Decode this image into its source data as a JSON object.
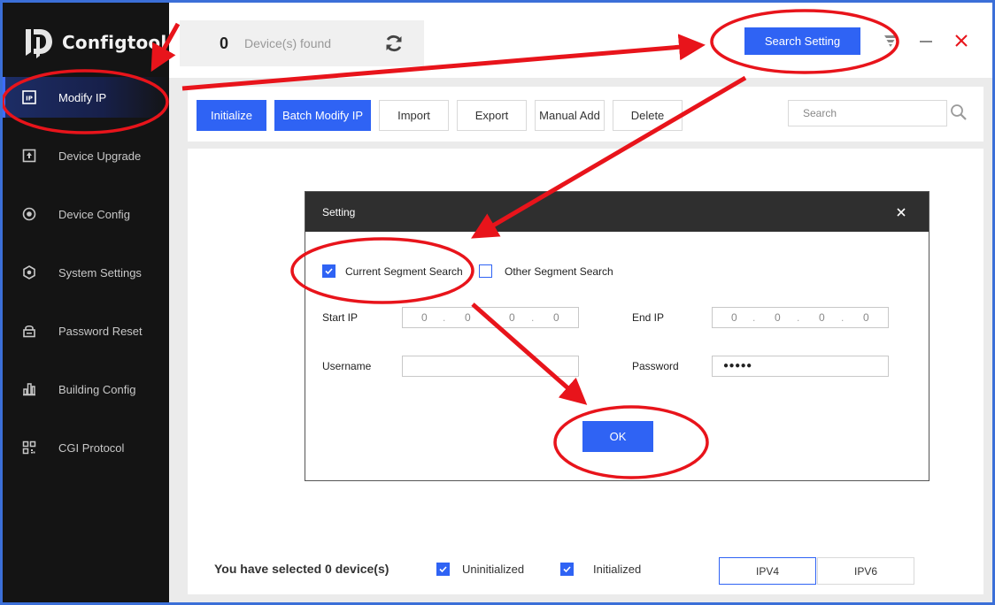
{
  "app": {
    "title": "Configtool"
  },
  "sidebar": {
    "items": [
      {
        "label": "Modify IP",
        "icon": "ip-icon",
        "active": true
      },
      {
        "label": "Device Upgrade",
        "icon": "upgrade-icon",
        "active": false
      },
      {
        "label": "Device Config",
        "icon": "config-icon",
        "active": false
      },
      {
        "label": "System Settings",
        "icon": "settings-icon",
        "active": false
      },
      {
        "label": "Password Reset",
        "icon": "lock-icon",
        "active": false
      },
      {
        "label": "Building Config",
        "icon": "building-icon",
        "active": false
      },
      {
        "label": "CGI Protocol",
        "icon": "qr-icon",
        "active": false
      }
    ]
  },
  "header": {
    "device_count": "0",
    "device_label": "Device(s) found",
    "search_setting_label": "Search Setting"
  },
  "toolbar": {
    "buttons": [
      {
        "label": "Initialize",
        "style": "primary"
      },
      {
        "label": "Batch Modify IP",
        "style": "primary"
      },
      {
        "label": "Import",
        "style": "plain"
      },
      {
        "label": "Export",
        "style": "plain"
      },
      {
        "label": "Manual Add",
        "style": "plain"
      },
      {
        "label": "Delete",
        "style": "plain"
      }
    ],
    "search_placeholder": "Search"
  },
  "dialog": {
    "title": "Setting",
    "current_segment_label": "Current Segment Search",
    "current_segment_checked": true,
    "other_segment_label": "Other Segment Search",
    "other_segment_checked": false,
    "start_ip_label": "Start  IP",
    "start_ip": [
      "0",
      "0",
      "0",
      "0"
    ],
    "end_ip_label": "End IP",
    "end_ip": [
      "0",
      "0",
      "0",
      "0"
    ],
    "ip_separator": ".",
    "username_label": "Username",
    "username_value": "",
    "password_label": "Password",
    "password_value": "●●●●●",
    "ok_label": "OK"
  },
  "footer": {
    "selected_text": "You have selected 0  device(s)",
    "uninitialized_label": "Uninitialized",
    "uninitialized_checked": true,
    "initialized_label": "Initialized",
    "initialized_checked": true,
    "ipv4_label": "IPV4",
    "ipv6_label": "IPV6"
  },
  "colors": {
    "accent": "#2f63f4",
    "sidebar_bg": "#141414",
    "annotation": "#e8141b",
    "close_red": "#e8141b"
  }
}
